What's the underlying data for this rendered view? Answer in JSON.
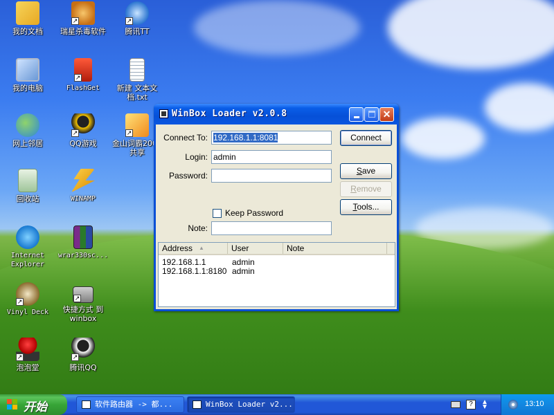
{
  "desktop": {
    "icons": [
      {
        "label": "我的文档",
        "icon": "my-documents-icon"
      },
      {
        "label": "瑞星杀毒软件",
        "icon": "rising-antivirus-icon"
      },
      {
        "label": "腾讯TT",
        "icon": "tencent-tt-icon"
      },
      {
        "label": "我的电脑",
        "icon": "my-computer-icon"
      },
      {
        "label": "FlashGet",
        "icon": "flashget-icon"
      },
      {
        "label": "新建 文本文档.txt",
        "icon": "text-document-icon"
      },
      {
        "label": "网上邻居",
        "icon": "network-places-icon"
      },
      {
        "label": "QQ游戏",
        "icon": "qq-game-icon"
      },
      {
        "label": "金山词霸2002 共享",
        "icon": "kingsoft-dictionary-icon"
      },
      {
        "label": "回收站",
        "icon": "recycle-bin-icon"
      },
      {
        "label": "WINAMP",
        "icon": "winamp-icon"
      },
      {
        "label": "Internet Explorer",
        "icon": "internet-explorer-icon"
      },
      {
        "label": "wrar330sc...",
        "icon": "winrar-icon"
      },
      {
        "label": "Vinyl Deck",
        "icon": "vinyl-deck-icon"
      },
      {
        "label": "快捷方式 到 winbox",
        "icon": "winbox-shortcut-icon"
      },
      {
        "label": "泡泡堂",
        "icon": "bnb-game-icon"
      },
      {
        "label": "腾讯QQ",
        "icon": "tencent-qq-icon"
      }
    ]
  },
  "window": {
    "title": "WinBox Loader v2.0.8",
    "connect_to_label": "Connect To:",
    "connect_to_value": "192.168.1.1:8081",
    "login_label": "Login:",
    "login_value": "admin",
    "password_label": "Password:",
    "password_value": "",
    "keep_password_label": "Keep Password",
    "keep_password_checked": false,
    "note_label": "Note:",
    "note_value": "",
    "buttons": {
      "connect": "Connect",
      "save": "Save",
      "remove": "Remove",
      "tools": "Tools..."
    },
    "list": {
      "columns": [
        "Address",
        "User",
        "Note"
      ],
      "rows": [
        {
          "address": "192.168.1.1",
          "user": "admin",
          "note": ""
        },
        {
          "address": "192.168.1.1:8180",
          "user": "admin",
          "note": ""
        }
      ]
    }
  },
  "taskbar": {
    "start_label": "开始",
    "tasks": [
      {
        "label": "软件路由器 -> 都...",
        "active": false
      },
      {
        "label": "WinBox Loader v2...",
        "active": true
      }
    ],
    "clock": "13:10"
  },
  "colors": {
    "title_bar": "#0a56e0",
    "taskbar": "#2157d7",
    "start_button": "#37a537",
    "selection": "#316ac5"
  }
}
